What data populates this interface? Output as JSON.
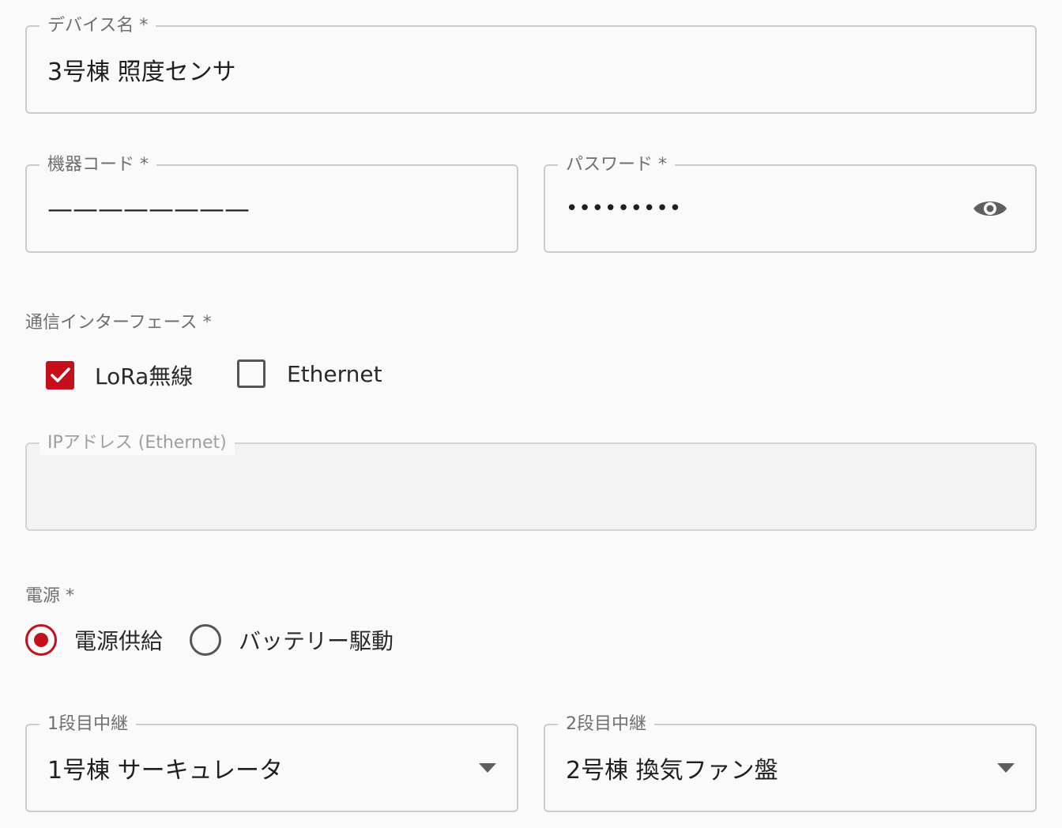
{
  "device_name": {
    "label": "デバイス名 *",
    "value": "3号棟 照度センサ"
  },
  "device_code": {
    "label": "機器コード *",
    "value": "————————"
  },
  "password": {
    "label": "パスワード *",
    "value": "•••••••••",
    "toggle_icon": "eye-icon"
  },
  "interface": {
    "label": "通信インターフェース *",
    "options": [
      {
        "label": "LoRa無線",
        "checked": true
      },
      {
        "label": "Ethernet",
        "checked": false
      }
    ]
  },
  "ip_address": {
    "label": "IPアドレス (Ethernet)",
    "value": "",
    "disabled": true
  },
  "power": {
    "label": "電源 *",
    "options": [
      {
        "label": "電源供給",
        "selected": true
      },
      {
        "label": "バッテリー駆動",
        "selected": false
      }
    ]
  },
  "relay1": {
    "label": "1段目中継",
    "value": "1号棟 サーキュレータ"
  },
  "relay2": {
    "label": "2段目中継",
    "value": "2号棟 換気ファン盤"
  },
  "colors": {
    "accent": "#c4101b",
    "border": "#cccccc",
    "label": "#6f6f6f"
  }
}
